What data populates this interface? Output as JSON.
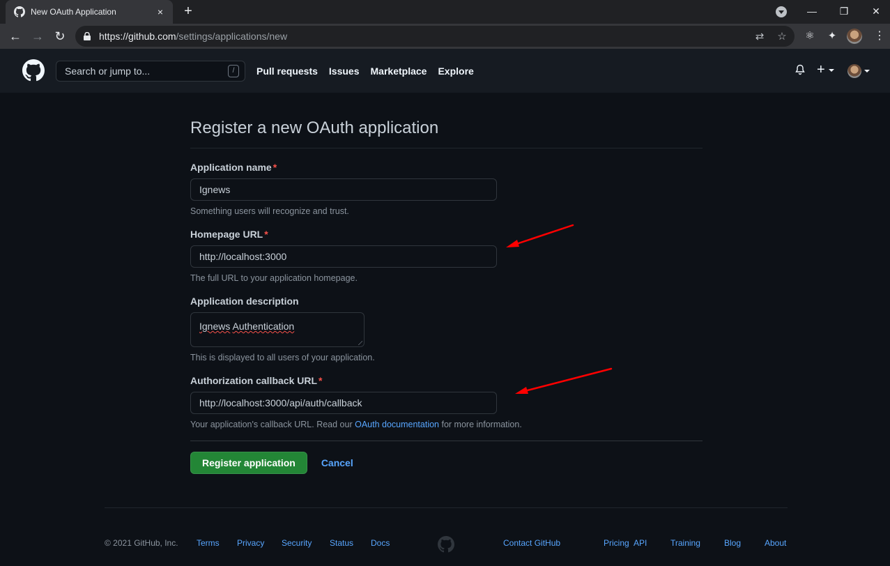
{
  "browser": {
    "tab_title": "New OAuth Application",
    "tab_close": "×",
    "new_tab": "+",
    "url_scheme": "https://",
    "url_host": "github.com",
    "url_path": "/settings/applications/new",
    "window_controls": {
      "minimize": "—",
      "restore": "❐",
      "close": "✕"
    },
    "nav": {
      "back": "←",
      "forward": "→",
      "reload": "↻"
    },
    "omnibox_icons": {
      "translate": "⇄",
      "bookmark": "☆"
    },
    "extensions": {
      "react_devtools": "⚛",
      "puzzle": "✦"
    },
    "menu": "⋮"
  },
  "header": {
    "search_placeholder": "Search or jump to...",
    "search_shortcut": "/",
    "nav": [
      "Pull requests",
      "Issues",
      "Marketplace",
      "Explore"
    ],
    "plus": "+"
  },
  "form": {
    "title": "Register a new OAuth application",
    "required_mark": "*",
    "fields": [
      {
        "label": "Application name",
        "required": true,
        "value": "Ignews",
        "note": "Something users will recognize and trust."
      },
      {
        "label": "Homepage URL",
        "required": true,
        "value": "http://localhost:3000",
        "note": "The full URL to your application homepage."
      },
      {
        "label": "Application description",
        "required": false,
        "value": "Ignews Authentication",
        "note": "This is displayed to all users of your application."
      },
      {
        "label": "Authorization callback URL",
        "required": true,
        "value": "http://localhost:3000/api/auth/callback",
        "note_before": "Your application's callback URL. Read our ",
        "note_link": "OAuth documentation",
        "note_after": " for more information."
      }
    ],
    "desc_word1": "Ignews",
    "desc_word2": "Authentication",
    "submit": "Register application",
    "cancel": "Cancel"
  },
  "annotations": {
    "arrow_color": "#ff0000"
  },
  "footer": {
    "copyright": "© 2021 GitHub, Inc.",
    "left_links": [
      "Terms",
      "Privacy",
      "Security",
      "Status",
      "Docs"
    ],
    "right_links": [
      "Contact GitHub",
      "Pricing",
      "API",
      "Training",
      "Blog",
      "About"
    ]
  },
  "colors": {
    "accent": "#58a6ff",
    "primary_button": "#238636",
    "required": "#f85149",
    "background": "#0d1117",
    "header": "#161b22"
  }
}
